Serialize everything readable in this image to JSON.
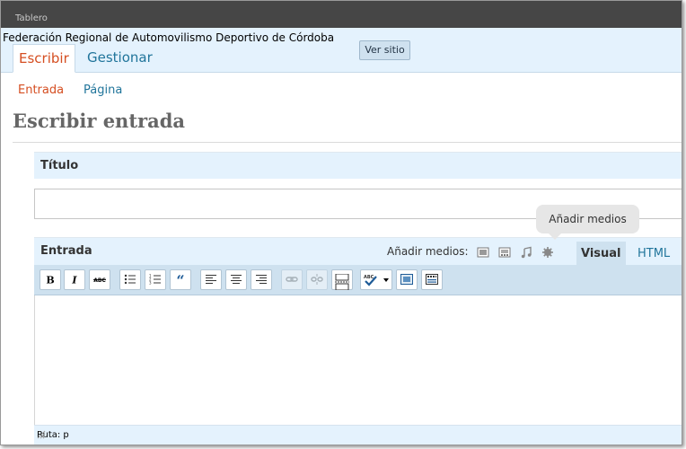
{
  "admin_bar": {
    "dashboard_label": "Tablero"
  },
  "header": {
    "site_name": "Federación Regional de Automovilismo Deportivo de Córdoba",
    "visit_site_label": "Ver sitio",
    "tabs": [
      {
        "label": "Escribir",
        "active": true
      },
      {
        "label": "Gestionar",
        "active": false
      }
    ]
  },
  "subnav": [
    {
      "label": "Entrada",
      "current": true
    },
    {
      "label": "Página",
      "current": false
    }
  ],
  "page": {
    "title": "Escribir entrada"
  },
  "title_box": {
    "label": "Título",
    "value": "",
    "placeholder": ""
  },
  "editor": {
    "label": "Entrada",
    "add_media_label": "Añadir medios:",
    "media_icons": [
      "image-icon",
      "video-icon",
      "audio-icon",
      "media-icon"
    ],
    "tooltip": "Añadir medios",
    "tabs": [
      {
        "label": "Visual",
        "active": true
      },
      {
        "label": "HTML",
        "active": false
      }
    ],
    "toolbar": [
      "bold",
      "italic",
      "strikethrough",
      "bullet-list",
      "numbered-list",
      "blockquote",
      "align-left",
      "align-center",
      "align-right",
      "link",
      "unlink",
      "more",
      "spellcheck",
      "fullscreen",
      "kitchen-sink"
    ],
    "path_label": "Ruta: p"
  },
  "colors": {
    "accent": "#d54e21",
    "link": "#21759b",
    "header_bg": "#e4f2fd",
    "admin_bar": "#464646"
  }
}
